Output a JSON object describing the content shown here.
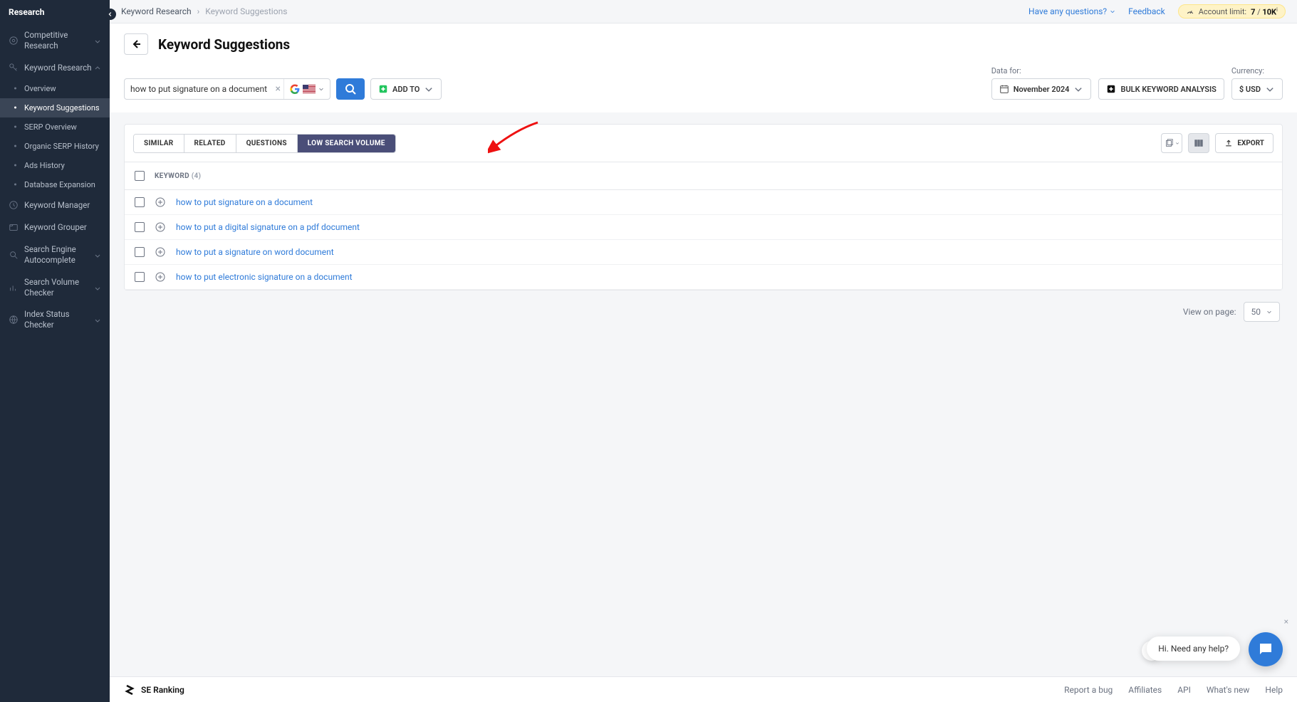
{
  "sidebar": {
    "title": "Research",
    "items": [
      {
        "label": "Competitive Research",
        "type": "group"
      },
      {
        "label": "Keyword Research",
        "type": "group",
        "expanded": true
      },
      {
        "label": "Keyword Manager",
        "type": "link"
      },
      {
        "label": "Keyword Grouper",
        "type": "link"
      },
      {
        "label": "Search Engine Autocomplete",
        "type": "group"
      },
      {
        "label": "Search Volume Checker",
        "type": "group"
      },
      {
        "label": "Index Status Checker",
        "type": "group"
      }
    ],
    "sub": [
      {
        "label": "Overview"
      },
      {
        "label": "Keyword Suggestions",
        "active": true
      },
      {
        "label": "SERP Overview"
      },
      {
        "label": "Organic SERP History"
      },
      {
        "label": "Ads History"
      },
      {
        "label": "Database Expansion"
      }
    ]
  },
  "breadcrumb": {
    "parent": "Keyword Research",
    "current": "Keyword Suggestions"
  },
  "topbar": {
    "question": "Have any questions?",
    "feedback": "Feedback",
    "account": {
      "prefix": "Account limit:",
      "used": "7",
      "sep": "/",
      "total": "10K",
      "info": "i"
    }
  },
  "page": {
    "title": "Keyword Suggestions"
  },
  "search": {
    "value": "how to put signature on a document",
    "add_to": "ADD TO"
  },
  "controls": {
    "data_for_label": "Data for:",
    "data_for_value": "November 2024",
    "bulk": "BULK KEYWORD ANALYSIS",
    "currency_label": "Currency:",
    "currency_value": "$ USD"
  },
  "tabs": [
    "SIMILAR",
    "RELATED",
    "QUESTIONS",
    "LOW SEARCH VOLUME"
  ],
  "active_tab": "LOW SEARCH VOLUME",
  "export": "EXPORT",
  "table": {
    "header": "KEYWORD",
    "count": "(4)",
    "rows": [
      "how to put signature on a document",
      "how to put a digital signature on a pdf document",
      "how to put a signature on word document",
      "how to put electronic signature on a document"
    ]
  },
  "pagination": {
    "label": "View on page:",
    "size": "50"
  },
  "footer": {
    "brand": "SE Ranking",
    "links": [
      "Report a bug",
      "Affiliates",
      "API",
      "What's new",
      "Help"
    ]
  },
  "chat": {
    "text": "Hi. Need any help?"
  }
}
